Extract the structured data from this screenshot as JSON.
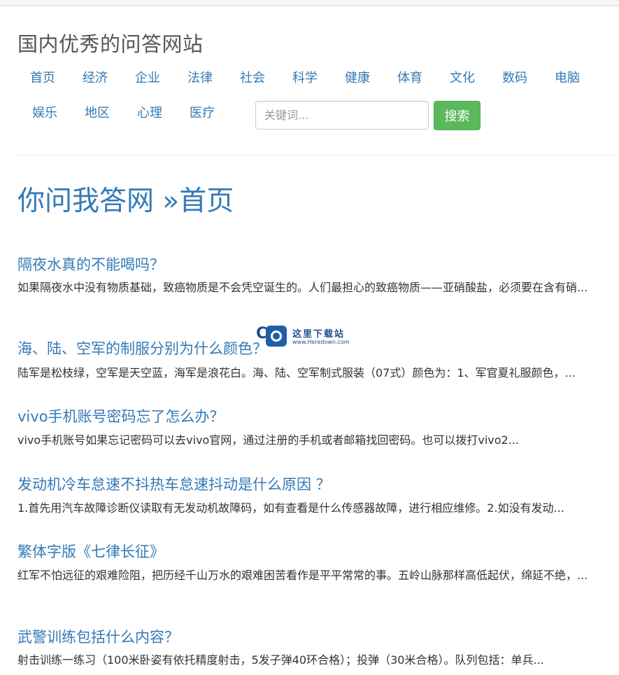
{
  "site": {
    "title": "国内优秀的问答网站"
  },
  "nav": {
    "items": [
      {
        "label": "首页"
      },
      {
        "label": "经济"
      },
      {
        "label": "企业"
      },
      {
        "label": "法律"
      },
      {
        "label": "社会"
      },
      {
        "label": "科学"
      },
      {
        "label": "健康"
      },
      {
        "label": "体育"
      },
      {
        "label": "文化"
      },
      {
        "label": "数码"
      },
      {
        "label": "电脑"
      },
      {
        "label": "娱乐"
      },
      {
        "label": "地区"
      },
      {
        "label": "心理"
      },
      {
        "label": "医疗"
      }
    ]
  },
  "search": {
    "placeholder": "关键词...",
    "value": "",
    "button_label": "搜索",
    "button_color": "#5cb85c"
  },
  "page": {
    "site_name": "你问我答网",
    "separator": "»",
    "section": "首页"
  },
  "questions": [
    {
      "title": "隔夜水真的不能喝吗？",
      "summary": "如果隔夜水中没有物质基础，致癌物质是不会凭空诞生的。人们最担心的致癌物质——亚硝酸盐，必须要在含有硝..."
    },
    {
      "title": "海、陆、空军的制服分别为什么颜色？",
      "summary": "陆军是松枝绿，空军是天空蓝，海军是浪花白。海、陆、空军制式服装（07式）颜色为：1、军官夏礼服颜色，..."
    },
    {
      "title": "vivo手机账号密码忘了怎么办？",
      "summary": "vivo手机账号如果忘记密码可以去vivo官网，通过注册的手机或者邮箱找回密码。也可以拨打vivo2..."
    },
    {
      "title": "发动机冷车怠速不抖热车怠速抖动是什么原因 ？",
      "summary": "1.首先用汽车故障诊断仪读取有无发动机故障码，如有查看是什么传感器故障，进行相应维修。2.如没有发动..."
    },
    {
      "title": "繁体字版《七律长征》",
      "summary": "红军不怕远征的艰难险阻，把历经千山万水的艰难困苦看作是平平常常的事。五岭山脉那样高低起伏，绵延不绝，..."
    },
    {
      "title": "武警训练包括什么内容？",
      "summary": "射击训练一练习（100米卧姿有依托精度射击，5发子弹40环合格）；投弹（30米合格）。队列包括：单兵..."
    }
  ],
  "watermark": {
    "icon": "heredown-logo-icon",
    "text_cn": "这里下载站",
    "text_en": "www.Heredown.com"
  },
  "colors": {
    "link": "#337ab7",
    "title_gray": "#555555",
    "text": "#333333"
  }
}
